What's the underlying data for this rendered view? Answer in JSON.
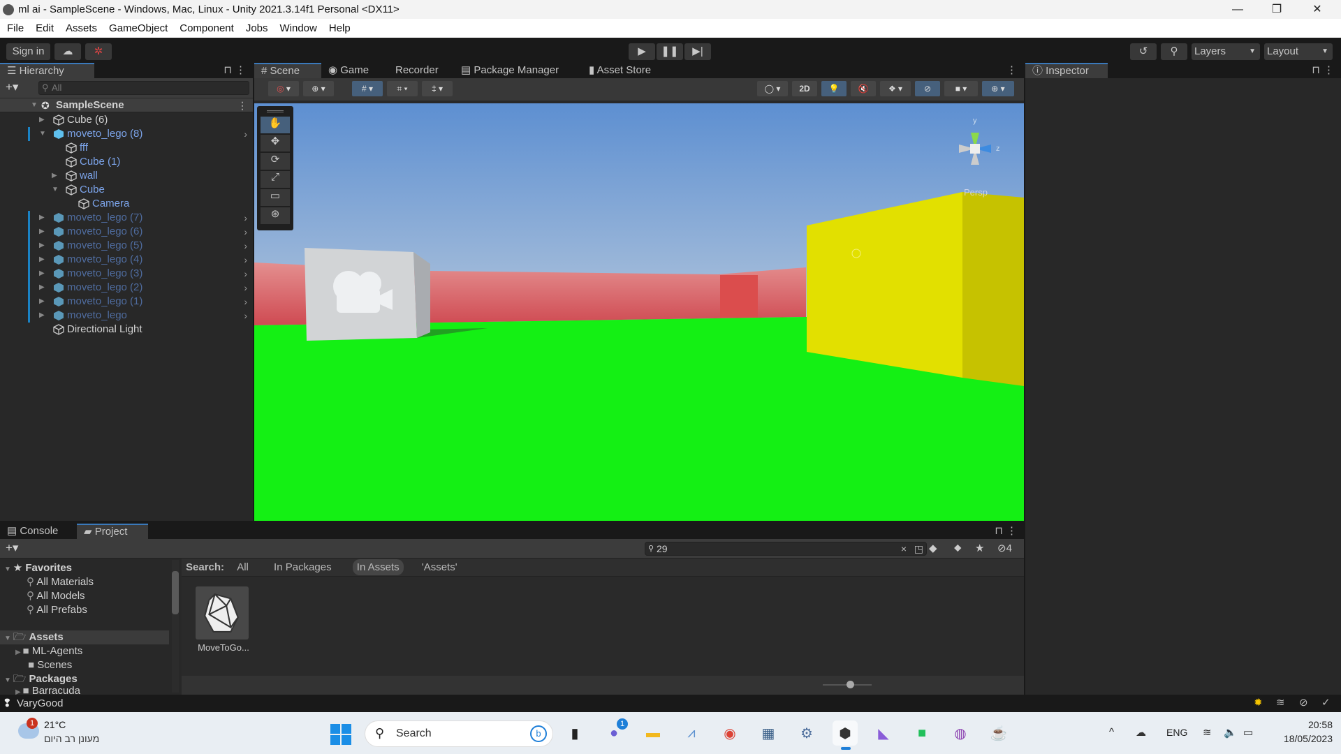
{
  "window": {
    "title": "ml ai - SampleScene - Windows, Mac, Linux - Unity 2021.3.14f1 Personal <DX11>",
    "minimize": "—",
    "restore": "❐",
    "close": "✕"
  },
  "menu": [
    "File",
    "Edit",
    "Assets",
    "GameObject",
    "Component",
    "Jobs",
    "Window",
    "Help"
  ],
  "toolbar": {
    "sign_in": "Sign in",
    "layers": "Layers",
    "layout": "Layout"
  },
  "hierarchy": {
    "tab": "Hierarchy",
    "search_placeholder": "All",
    "scene": "SampleScene",
    "items": [
      {
        "name": "Cube (6)",
        "depth": 0,
        "arrow": "right",
        "type": "object",
        "style": "normal"
      },
      {
        "name": "moveto_lego (8)",
        "depth": 0,
        "arrow": "down",
        "type": "prefab",
        "style": "prefab",
        "chevron": true
      },
      {
        "name": "fff",
        "depth": 1,
        "arrow": "",
        "type": "object",
        "style": "prefab"
      },
      {
        "name": "Cube (1)",
        "depth": 1,
        "arrow": "",
        "type": "object",
        "style": "prefab"
      },
      {
        "name": "wall",
        "depth": 1,
        "arrow": "right",
        "type": "object",
        "style": "prefab"
      },
      {
        "name": "Cube",
        "depth": 1,
        "arrow": "down",
        "type": "object",
        "style": "prefab"
      },
      {
        "name": "Camera",
        "depth": 2,
        "arrow": "",
        "type": "object",
        "style": "prefab"
      },
      {
        "name": "moveto_lego (7)",
        "depth": 0,
        "arrow": "right",
        "type": "prefab",
        "style": "inactive",
        "chevron": true
      },
      {
        "name": "moveto_lego (6)",
        "depth": 0,
        "arrow": "right",
        "type": "prefab",
        "style": "inactive",
        "chevron": true
      },
      {
        "name": "moveto_lego (5)",
        "depth": 0,
        "arrow": "right",
        "type": "prefab",
        "style": "inactive",
        "chevron": true
      },
      {
        "name": "moveto_lego (4)",
        "depth": 0,
        "arrow": "right",
        "type": "prefab",
        "style": "inactive",
        "chevron": true
      },
      {
        "name": "moveto_lego (3)",
        "depth": 0,
        "arrow": "right",
        "type": "prefab",
        "style": "inactive",
        "chevron": true
      },
      {
        "name": "moveto_lego (2)",
        "depth": 0,
        "arrow": "right",
        "type": "prefab",
        "style": "inactive",
        "chevron": true
      },
      {
        "name": "moveto_lego (1)",
        "depth": 0,
        "arrow": "right",
        "type": "prefab",
        "style": "inactive",
        "chevron": true
      },
      {
        "name": "moveto_lego",
        "depth": 0,
        "arrow": "right",
        "type": "prefab",
        "style": "inactive",
        "chevron": true
      },
      {
        "name": "Directional Light",
        "depth": 0,
        "arrow": "",
        "type": "object",
        "style": "normal"
      }
    ]
  },
  "scene_tabs": [
    "Scene",
    "Game",
    "Recorder",
    "Package Manager",
    "Asset Store"
  ],
  "scene": {
    "toggle_2d": "2D",
    "persp": "Persp",
    "axes": {
      "y": "y",
      "z": "z"
    }
  },
  "inspector": {
    "tab": "Inspector"
  },
  "bottom": {
    "tabs": [
      "Console",
      "Project"
    ],
    "search_value": "29",
    "hidden_count": "4",
    "search_label": "Search:",
    "filters": [
      "All",
      "In Packages",
      "In Assets",
      "'Assets'"
    ],
    "active_filter": "In Assets",
    "favorites": {
      "label": "Favorites",
      "items": [
        "All Materials",
        "All Models",
        "All Prefabs"
      ]
    },
    "assets": {
      "label": "Assets",
      "items": [
        {
          "name": "ML-Agents",
          "arrow": true
        },
        {
          "name": "Scenes",
          "arrow": false
        }
      ]
    },
    "packages": {
      "label": "Packages",
      "items": [
        {
          "name": "Barracuda",
          "arrow": true
        }
      ]
    },
    "asset_item": "MoveToGo..."
  },
  "status": {
    "message": "VaryGood"
  },
  "taskbar": {
    "weather_temp": "21°C",
    "weather_desc": "מעונן רב היום",
    "weather_badge": "1",
    "search": "Search",
    "teams_badge": "1",
    "lang": "ENG",
    "time": "20:58",
    "date": "18/05/2023"
  },
  "colors": {
    "accent": "#3a79bb",
    "ground": "#14f014",
    "prefab_text": "#7ca4ea",
    "inactive_text": "#4f6c9f",
    "yellow_cube": "#e2e000"
  }
}
